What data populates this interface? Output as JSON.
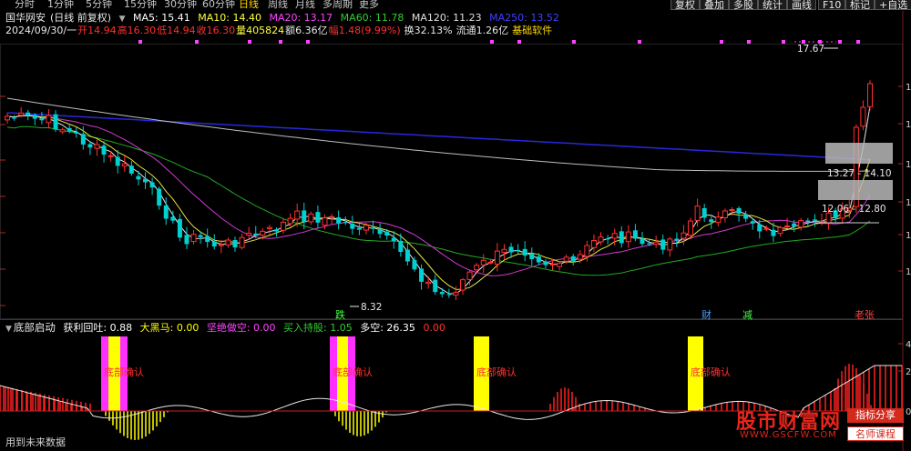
{
  "toolbar": {
    "periods": [
      "分时",
      "1分钟",
      "5分钟",
      "15分钟",
      "30分钟",
      "60分钟",
      "日线",
      "周线",
      "月线",
      "多周期",
      "更多"
    ],
    "active": "日线",
    "right_buttons": [
      "复权",
      "叠加",
      "多股",
      "统计",
      "画线",
      "F10",
      "标记",
      "+自选"
    ]
  },
  "header": {
    "stock_name": "国华网安",
    "mode": "(日线 前复权)",
    "ma": [
      {
        "label": "MA5: 15.41",
        "color": "#ffffff"
      },
      {
        "label": "MA10: 14.40",
        "color": "#ffff40"
      },
      {
        "label": "MA20: 13.17",
        "color": "#ff44ff"
      },
      {
        "label": "MA60: 11.78",
        "color": "#32cd32"
      },
      {
        "label": "MA120: 11.23",
        "color": "#e0e0e0"
      },
      {
        "label": "MA250: 13.52",
        "color": "#4040ff"
      }
    ]
  },
  "quote": {
    "date": "2024/09/30/一",
    "open": "开14.94",
    "high": "高16.30",
    "low": "低14.94",
    "close": "收16.30",
    "volume": "量405824",
    "amount": "额6.36亿",
    "change": "幅1.48(9.99%)",
    "turnover": "换32.13%",
    "float": "流通1.26亿",
    "sector": "基础软件"
  },
  "chart_data": {
    "type": "candlestick",
    "price_labels": [
      "17.67",
      "8.32",
      "13.27 - 14.10",
      "12.06 - 12.80"
    ],
    "markers": [
      "跌",
      "财",
      "减",
      "老张"
    ],
    "right_axis_ticks": [
      "1",
      "1",
      "1",
      "1",
      "1",
      "1"
    ],
    "sub_axis_ticks": [
      "4",
      "2",
      "0"
    ]
  },
  "indicator": {
    "name": "底部启动",
    "values": [
      {
        "label": "获利回吐: 0.88",
        "color": "#ffffff"
      },
      {
        "label": "大黑马: 0.00",
        "color": "#ffff00"
      },
      {
        "label": "坚绝做空: 0.00",
        "color": "#ff44ff"
      },
      {
        "label": "买入持股: 1.05",
        "color": "#32cd32"
      },
      {
        "label": "多空: 26.35",
        "color": "#ffffff"
      },
      {
        "label": "0.00",
        "color": "#ff3030"
      }
    ],
    "signal_label": "底部确认"
  },
  "footer": {
    "future_label": "用到未来数据"
  },
  "watermark": {
    "site_name": "股市财富网",
    "url": "WWW.GSCFW.COM",
    "tag1": "指标分享",
    "tag2": "名师课程"
  }
}
